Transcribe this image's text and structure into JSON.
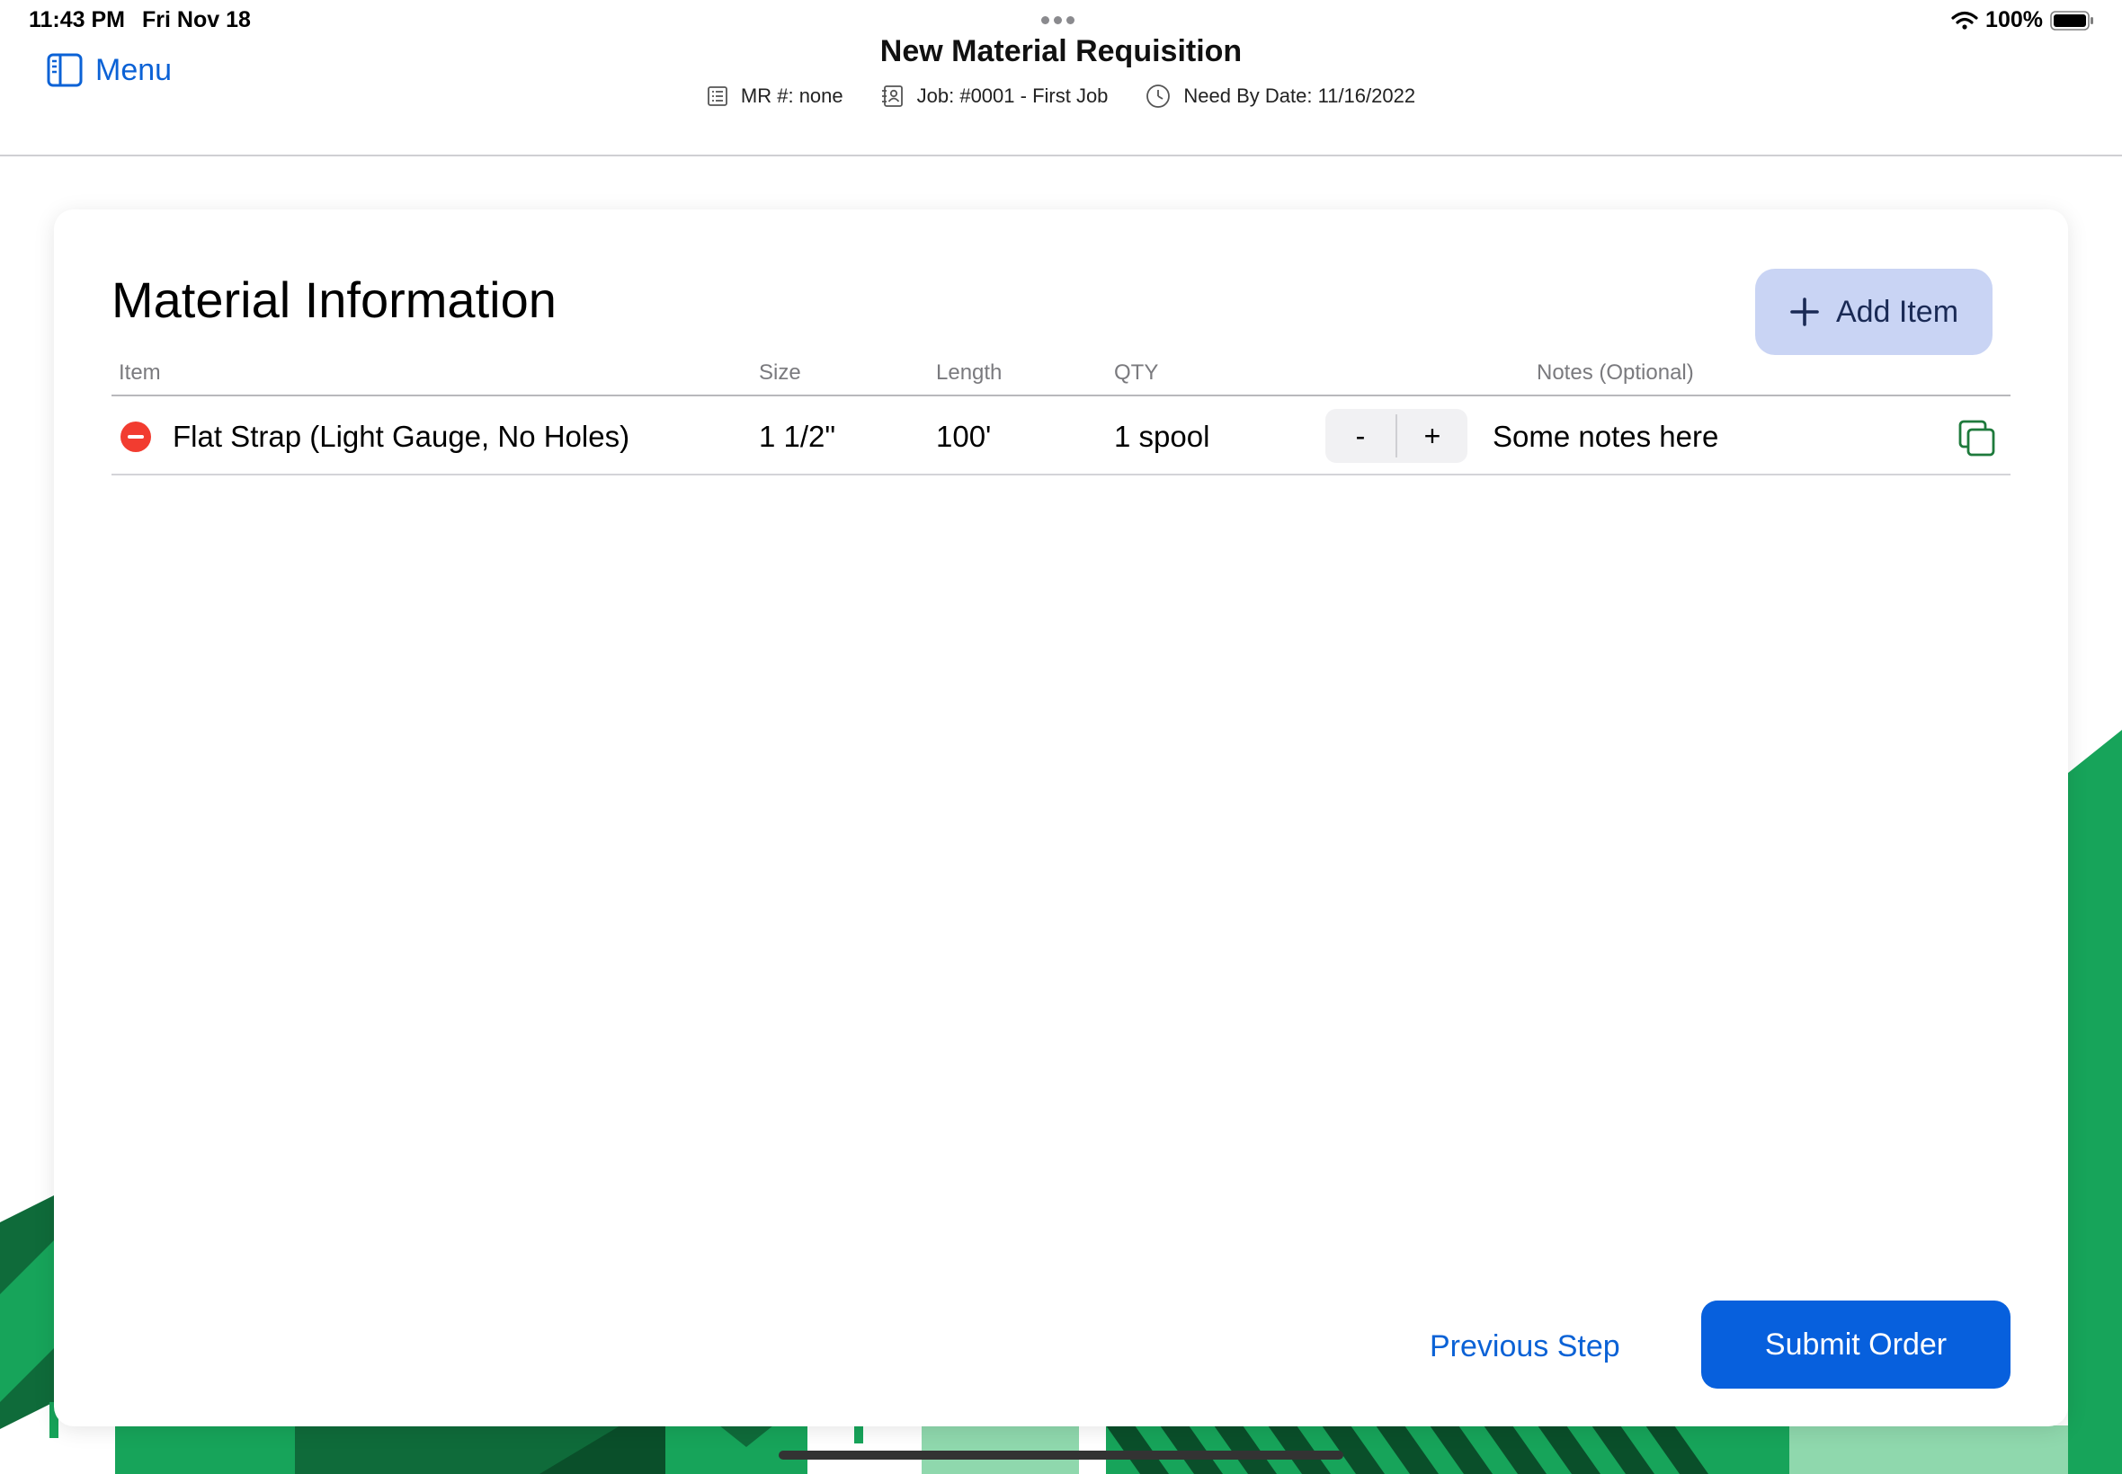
{
  "status_bar": {
    "time": "11:43 PM",
    "date": "Fri Nov 18",
    "battery": "100%"
  },
  "header": {
    "menu_label": "Menu",
    "title": "New Material Requisition",
    "meta": {
      "mr_number": "MR #: none",
      "job": "Job: #0001 - First Job",
      "need_by": "Need By Date: 11/16/2022"
    }
  },
  "card": {
    "title": "Material Information",
    "add_item_label": "Add Item",
    "columns": {
      "item": "Item",
      "size": "Size",
      "length": "Length",
      "qty": "QTY",
      "notes": "Notes (Optional)"
    },
    "rows": [
      {
        "item": "Flat Strap (Light Gauge, No Holes)",
        "size": "1 1/2\"",
        "length": "100'",
        "qty": "1 spool",
        "decrement": "-",
        "increment": "+",
        "notes": "Some notes here"
      }
    ]
  },
  "footer": {
    "previous_label": "Previous Step",
    "submit_label": "Submit Order"
  },
  "colors": {
    "accent": "#0760dd",
    "link": "#0b62d6",
    "add_button_bg": "#c9d4f4",
    "remove_red": "#f23c30",
    "copy_green": "#1e7a3c",
    "bg_green_dark": "#0f6b3a",
    "bg_green": "#17a45a",
    "bg_green_light": "#8fd8ad"
  },
  "icons": {
    "menu": "sidebar-icon",
    "mr": "list-icon",
    "job": "contact-card-icon",
    "need_by": "clock-icon",
    "add": "plus-icon",
    "remove": "minus-circle-icon",
    "copy": "duplicate-icon"
  }
}
